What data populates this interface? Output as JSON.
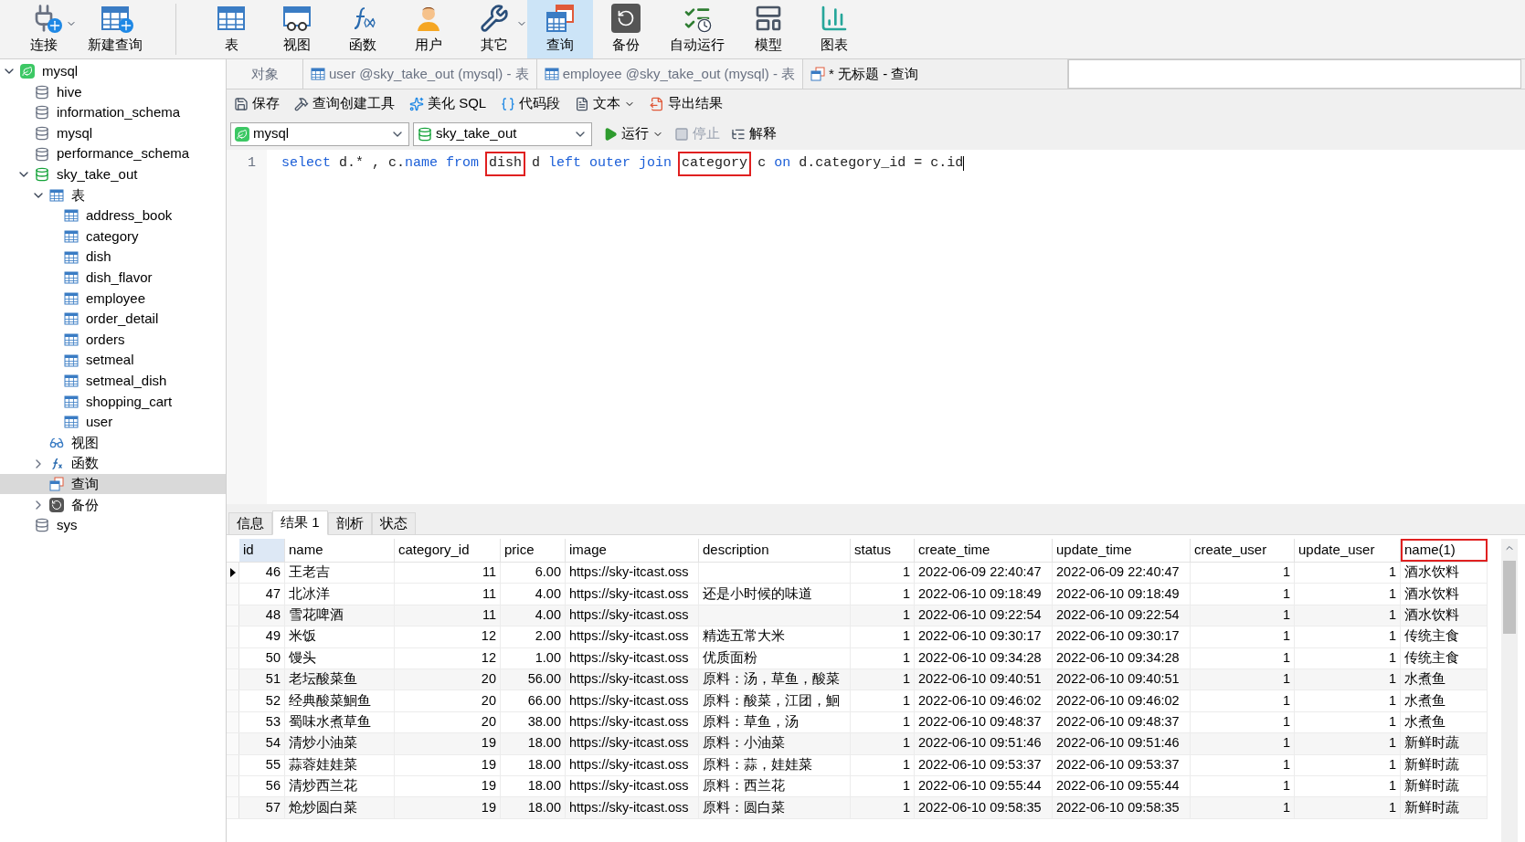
{
  "toolbar": [
    {
      "label": "连接",
      "selected": false,
      "dropdown": true
    },
    {
      "label": "新建查询",
      "selected": false,
      "dropdown": false
    },
    {
      "label": "表",
      "selected": false,
      "dropdown": false
    },
    {
      "label": "视图",
      "selected": false,
      "dropdown": false
    },
    {
      "label": "函数",
      "selected": false,
      "dropdown": false
    },
    {
      "label": "用户",
      "selected": false,
      "dropdown": false
    },
    {
      "label": "其它",
      "selected": false,
      "dropdown": true
    },
    {
      "label": "查询",
      "selected": true,
      "dropdown": false
    },
    {
      "label": "备份",
      "selected": false,
      "dropdown": false
    },
    {
      "label": "自动运行",
      "selected": false,
      "dropdown": false
    },
    {
      "label": "模型",
      "selected": false,
      "dropdown": false
    },
    {
      "label": "图表",
      "selected": false,
      "dropdown": false
    }
  ],
  "sidebar": {
    "items": [
      {
        "label": "mysql",
        "kind": "connection",
        "expanded": true,
        "selected": false,
        "children": [
          {
            "label": "hive",
            "kind": "database",
            "selected": false
          },
          {
            "label": "information_schema",
            "kind": "database",
            "selected": false
          },
          {
            "label": "mysql",
            "kind": "database",
            "selected": false
          },
          {
            "label": "performance_schema",
            "kind": "database",
            "selected": false
          },
          {
            "label": "sky_take_out",
            "kind": "open-database",
            "expanded": true,
            "selected": false,
            "children": [
              {
                "label": "表",
                "kind": "tables",
                "expanded": true,
                "selected": false,
                "children": [
                  {
                    "label": "address_book",
                    "kind": "table",
                    "selected": false
                  },
                  {
                    "label": "category",
                    "kind": "table",
                    "selected": false
                  },
                  {
                    "label": "dish",
                    "kind": "table",
                    "selected": false
                  },
                  {
                    "label": "dish_flavor",
                    "kind": "table",
                    "selected": false
                  },
                  {
                    "label": "employee",
                    "kind": "table",
                    "selected": false
                  },
                  {
                    "label": "order_detail",
                    "kind": "table",
                    "selected": false
                  },
                  {
                    "label": "orders",
                    "kind": "table",
                    "selected": false
                  },
                  {
                    "label": "setmeal",
                    "kind": "table",
                    "selected": false
                  },
                  {
                    "label": "setmeal_dish",
                    "kind": "table",
                    "selected": false
                  },
                  {
                    "label": "shopping_cart",
                    "kind": "table",
                    "selected": false
                  },
                  {
                    "label": "user",
                    "kind": "table",
                    "selected": false
                  }
                ]
              },
              {
                "label": "视图",
                "kind": "views",
                "selected": false
              },
              {
                "label": "函数",
                "kind": "functions",
                "expanded": false,
                "selected": false
              },
              {
                "label": "查询",
                "kind": "queries",
                "selected": true
              },
              {
                "label": "备份",
                "kind": "backups",
                "expanded": false,
                "selected": false
              }
            ]
          },
          {
            "label": "sys",
            "kind": "database",
            "selected": false
          }
        ]
      }
    ]
  },
  "tabs": [
    {
      "label": "对象",
      "kind": "objects",
      "selected": false
    },
    {
      "label": "user @sky_take_out (mysql) - 表",
      "kind": "table",
      "selected": false
    },
    {
      "label": "employee @sky_take_out (mysql) - 表",
      "kind": "table",
      "selected": false
    },
    {
      "label": "* 无标题 - 查询",
      "kind": "query",
      "selected": true
    }
  ],
  "editor_toolbar": [
    {
      "label": "保存",
      "dropdown": false
    },
    {
      "label": "查询创建工具",
      "dropdown": false
    },
    {
      "label": "美化 SQL",
      "dropdown": false
    },
    {
      "label": "代码段",
      "dropdown": false
    },
    {
      "label": "文本",
      "dropdown": true
    },
    {
      "label": "导出结果",
      "dropdown": false
    }
  ],
  "connection_select": {
    "value": "mysql"
  },
  "database_select": {
    "value": "sky_take_out"
  },
  "run_controls": [
    {
      "label": "运行",
      "dropdown": true,
      "disabled": false
    },
    {
      "label": "停止",
      "dropdown": false,
      "disabled": true
    },
    {
      "label": "解释",
      "dropdown": false,
      "disabled": false
    }
  ],
  "editor": {
    "lines": [
      {
        "number": "1",
        "tokens": [
          {
            "text": "select",
            "kind": "keyword",
            "highlighted": false
          },
          {
            "text": " d.* , c.",
            "kind": "plain",
            "highlighted": false
          },
          {
            "text": "name from ",
            "kind": "keyword",
            "highlighted": false
          },
          {
            "text": "dish",
            "kind": "plain",
            "highlighted": true
          },
          {
            "text": " d ",
            "kind": "plain",
            "highlighted": false
          },
          {
            "text": "left outer join ",
            "kind": "keyword",
            "highlighted": false
          },
          {
            "text": "category",
            "kind": "plain",
            "highlighted": true
          },
          {
            "text": " c ",
            "kind": "plain",
            "highlighted": false
          },
          {
            "text": "on",
            "kind": "keyword",
            "highlighted": false
          },
          {
            "text": " d.category_id = c.id",
            "kind": "plain",
            "highlighted": false
          }
        ]
      }
    ]
  },
  "result_tabs": [
    {
      "label": "信息",
      "selected": false
    },
    {
      "label": "结果 1",
      "selected": true
    },
    {
      "label": "剖析",
      "selected": false
    },
    {
      "label": "状态",
      "selected": false
    }
  ],
  "table": {
    "columns": [
      {
        "label": "id",
        "selected": true,
        "highlighted": false
      },
      {
        "label": "name",
        "selected": false,
        "highlighted": false
      },
      {
        "label": "category_id",
        "selected": false,
        "highlighted": false
      },
      {
        "label": "price",
        "selected": false,
        "highlighted": false
      },
      {
        "label": "image",
        "selected": false,
        "highlighted": false
      },
      {
        "label": "description",
        "selected": false,
        "highlighted": false
      },
      {
        "label": "status",
        "selected": false,
        "highlighted": false
      },
      {
        "label": "create_time",
        "selected": false,
        "highlighted": false
      },
      {
        "label": "update_time",
        "selected": false,
        "highlighted": false
      },
      {
        "label": "create_user",
        "selected": false,
        "highlighted": false
      },
      {
        "label": "update_user",
        "selected": false,
        "highlighted": false
      },
      {
        "label": "name(1)",
        "selected": false,
        "highlighted": true
      }
    ],
    "rows": [
      {
        "selected": true,
        "cells": [
          "46",
          "王老吉",
          "11",
          "6.00",
          "https://sky-itcast.oss",
          "",
          "1",
          "2022-06-09 22:40:47",
          "2022-06-09 22:40:47",
          "1",
          "1",
          "酒水饮料"
        ]
      },
      {
        "selected": false,
        "cells": [
          "47",
          "北冰洋",
          "11",
          "4.00",
          "https://sky-itcast.oss",
          "还是小时候的味道",
          "1",
          "2022-06-10 09:18:49",
          "2022-06-10 09:18:49",
          "1",
          "1",
          "酒水饮料"
        ]
      },
      {
        "selected": false,
        "cells": [
          "48",
          "雪花啤酒",
          "11",
          "4.00",
          "https://sky-itcast.oss",
          "",
          "1",
          "2022-06-10 09:22:54",
          "2022-06-10 09:22:54",
          "1",
          "1",
          "酒水饮料"
        ]
      },
      {
        "selected": false,
        "cells": [
          "49",
          "米饭",
          "12",
          "2.00",
          "https://sky-itcast.oss",
          "精选五常大米",
          "1",
          "2022-06-10 09:30:17",
          "2022-06-10 09:30:17",
          "1",
          "1",
          "传统主食"
        ]
      },
      {
        "selected": false,
        "cells": [
          "50",
          "馒头",
          "12",
          "1.00",
          "https://sky-itcast.oss",
          "优质面粉",
          "1",
          "2022-06-10 09:34:28",
          "2022-06-10 09:34:28",
          "1",
          "1",
          "传统主食"
        ]
      },
      {
        "selected": false,
        "cells": [
          "51",
          "老坛酸菜鱼",
          "20",
          "56.00",
          "https://sky-itcast.oss",
          "原料：汤，草鱼，酸菜",
          "1",
          "2022-06-10 09:40:51",
          "2022-06-10 09:40:51",
          "1",
          "1",
          "水煮鱼"
        ]
      },
      {
        "selected": false,
        "cells": [
          "52",
          "经典酸菜鮰鱼",
          "20",
          "66.00",
          "https://sky-itcast.oss",
          "原料：酸菜，江团，鮰",
          "1",
          "2022-06-10 09:46:02",
          "2022-06-10 09:46:02",
          "1",
          "1",
          "水煮鱼"
        ]
      },
      {
        "selected": false,
        "cells": [
          "53",
          "蜀味水煮草鱼",
          "20",
          "38.00",
          "https://sky-itcast.oss",
          "原料：草鱼，汤",
          "1",
          "2022-06-10 09:48:37",
          "2022-06-10 09:48:37",
          "1",
          "1",
          "水煮鱼"
        ]
      },
      {
        "selected": false,
        "cells": [
          "54",
          "清炒小油菜",
          "19",
          "18.00",
          "https://sky-itcast.oss",
          "原料：小油菜",
          "1",
          "2022-06-10 09:51:46",
          "2022-06-10 09:51:46",
          "1",
          "1",
          "新鲜时蔬"
        ]
      },
      {
        "selected": false,
        "cells": [
          "55",
          "蒜蓉娃娃菜",
          "19",
          "18.00",
          "https://sky-itcast.oss",
          "原料：蒜，娃娃菜",
          "1",
          "2022-06-10 09:53:37",
          "2022-06-10 09:53:37",
          "1",
          "1",
          "新鲜时蔬"
        ]
      },
      {
        "selected": false,
        "cells": [
          "56",
          "清炒西兰花",
          "19",
          "18.00",
          "https://sky-itcast.oss",
          "原料：西兰花",
          "1",
          "2022-06-10 09:55:44",
          "2022-06-10 09:55:44",
          "1",
          "1",
          "新鲜时蔬"
        ]
      },
      {
        "selected": false,
        "cells": [
          "57",
          "炝炒圆白菜",
          "19",
          "18.00",
          "https://sky-itcast.oss",
          "原料：圆白菜",
          "1",
          "2022-06-10 09:58:35",
          "2022-06-10 09:58:35",
          "1",
          "1",
          "新鲜时蔬"
        ]
      }
    ]
  }
}
